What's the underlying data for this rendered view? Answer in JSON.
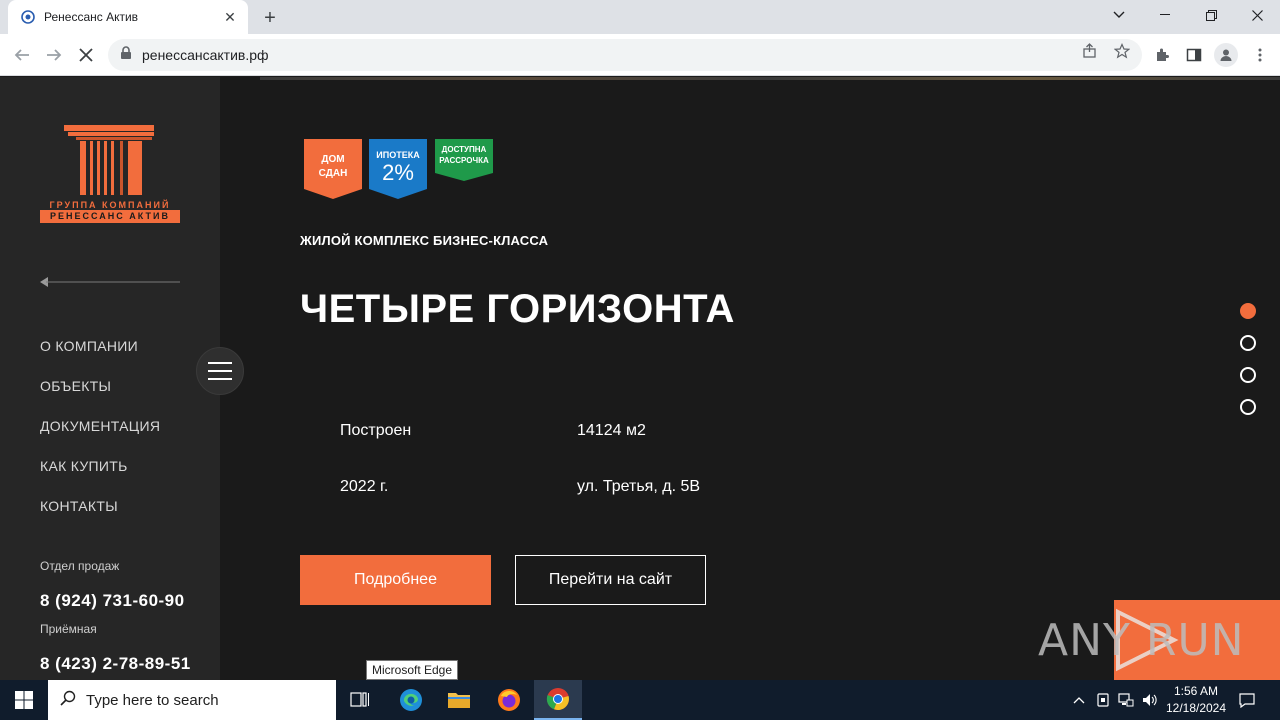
{
  "browser": {
    "tab_title": "Ренессанс Актив",
    "url": "ренессансактив.рф",
    "new_tab_symbol": "+",
    "close_symbol": "✕"
  },
  "sidebar": {
    "logo_line1": "ГРУППА КОМПАНИЙ",
    "logo_line2": "РЕНЕССАНС АКТИВ",
    "menu": [
      "О КОМПАНИИ",
      "ОБЪЕКТЫ",
      "ДОКУМЕНТАЦИЯ",
      "КАК КУПИТЬ",
      "КОНТАКТЫ"
    ],
    "contacts": [
      {
        "label": "Отдел продаж",
        "phone": "8 (924) 731-60-90"
      },
      {
        "label": "Приёмная",
        "phone": "8 (423) 2-78-89-51"
      }
    ]
  },
  "badges": [
    {
      "line1": "ДОМ",
      "line2": "СДАН",
      "color": "#f26d3d"
    },
    {
      "line1": "ИПОТЕКА",
      "line2": "2%",
      "color": "#1a7ac8"
    },
    {
      "line1": "ДОСТУПНА",
      "line2": "РАССРОЧКА",
      "color": "#1f9a4a"
    }
  ],
  "hero": {
    "subtitle": "ЖИЛОЙ КОМПЛЕКС БИЗНЕС-КЛАССА",
    "title": "ЧЕТЫРЕ ГОРИЗОНТА",
    "facts": {
      "status": "Построен",
      "area": "14124 м2",
      "year": "2022 г.",
      "address": "ул. Третья, д. 5В"
    },
    "primary_button": "Подробнее",
    "secondary_button": "Перейти на сайт"
  },
  "slider": {
    "count": 4,
    "active_index": 0
  },
  "watermark": "ANY RUN",
  "tooltip": "Microsoft Edge",
  "taskbar": {
    "search_placeholder": "Type here to search",
    "time": "1:56 AM",
    "date": "12/18/2024"
  },
  "colors": {
    "accent": "#f26d3d",
    "sidebar_bg": "#262626",
    "hero_bg": "#1a1a1a"
  }
}
